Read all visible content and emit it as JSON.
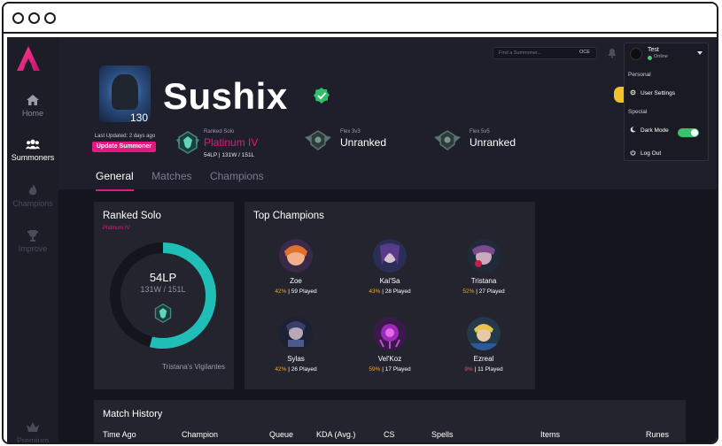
{
  "sidebar": {
    "items": [
      {
        "label": "Home",
        "icon": "home-icon"
      },
      {
        "label": "Summoners",
        "icon": "users-icon"
      },
      {
        "label": "Champions",
        "icon": "flame-icon"
      },
      {
        "label": "Improve",
        "icon": "trophy-icon"
      },
      {
        "label": "Premium",
        "icon": "crown-icon"
      }
    ]
  },
  "search": {
    "placeholder": "Find a Summoner...",
    "region": "OCE"
  },
  "user_menu": {
    "username": "Test",
    "status": "Online",
    "section_personal": "Personal",
    "user_settings": "User Settings",
    "section_special": "Special",
    "dark_mode": "Dark Mode",
    "log_out": "Log Out"
  },
  "profile": {
    "name": "Sushix",
    "level": "130",
    "last_updated": "Last Updated: 2 days ago",
    "update_button": "Update Summoner"
  },
  "ranks": [
    {
      "queue": "Ranked Solo",
      "tier": "Platinum IV",
      "record": "54LP | 131W / 151L",
      "tier_color": "#e2197f"
    },
    {
      "queue": "Flex 3v3",
      "tier": "Unranked",
      "record": "",
      "tier_color": "#ffffff"
    },
    {
      "queue": "Flex 5v5",
      "tier": "Unranked",
      "record": "",
      "tier_color": "#ffffff"
    }
  ],
  "tabs": [
    "General",
    "Matches",
    "Champions"
  ],
  "ranked_solo_card": {
    "title": "Ranked Solo",
    "tier": "Platinum IV",
    "lp": "54LP",
    "record": "131W / 151L",
    "lp_fraction": 0.54,
    "league": "Tristana's Vigilantes",
    "accent": "#1fbfb8"
  },
  "top_champions": {
    "title": "Top Champions",
    "items": [
      {
        "name": "Zoe",
        "winrate": "42%",
        "played": "59 Played",
        "wr_color": "#f5a623"
      },
      {
        "name": "Kai'Sa",
        "winrate": "43%",
        "played": "28 Played",
        "wr_color": "#f5a623"
      },
      {
        "name": "Tristana",
        "winrate": "52%",
        "played": "27 Played",
        "wr_color": "#f5a623"
      },
      {
        "name": "Sylas",
        "winrate": "42%",
        "played": "26 Played",
        "wr_color": "#f5a623"
      },
      {
        "name": "Vel'Koz",
        "winrate": "59%",
        "played": "17 Played",
        "wr_color": "#f5a623"
      },
      {
        "name": "Ezreal",
        "winrate": "9%",
        "played": "11 Played",
        "wr_color": "#e94f4f"
      }
    ]
  },
  "match_history": {
    "title": "Match History",
    "columns": [
      "Time Ago",
      "Champion",
      "Queue",
      "KDA (Avg.)",
      "CS",
      "Spells",
      "Items",
      "Runes"
    ]
  },
  "colors": {
    "brand": "#e2197f",
    "online": "#3ed16b",
    "gold": "#f5a623"
  }
}
